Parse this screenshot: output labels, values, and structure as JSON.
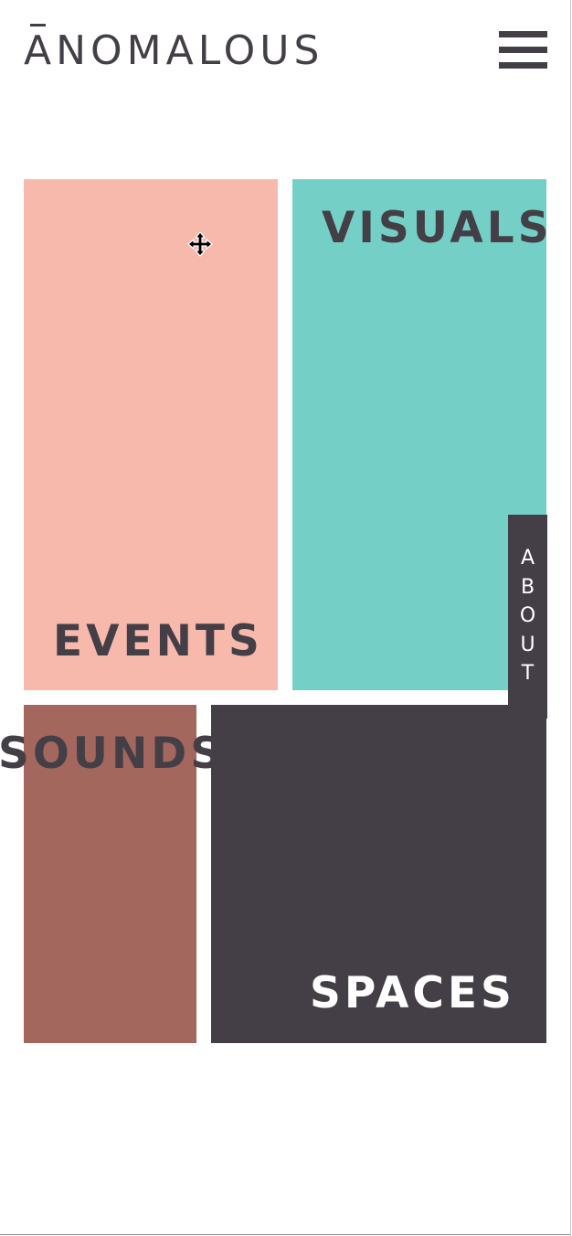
{
  "header": {
    "logo_text": "ANOMALOUS",
    "menu_icon": "hamburger-menu-icon"
  },
  "tiles": {
    "events": {
      "label": "EVENTS",
      "color": "#f7b9ac"
    },
    "visuals": {
      "label": "VISUALS",
      "color": "#74d0c6"
    },
    "sounds": {
      "label": "SOUNDS",
      "color": "#a3675e"
    },
    "spaces": {
      "label": "SPACES",
      "color": "#443f47"
    }
  },
  "about_tab": {
    "letters": [
      "A",
      "B",
      "O",
      "U",
      "T"
    ]
  },
  "colors": {
    "brand_dark": "#443f47",
    "background": "#ffffff",
    "on_dark_text": "#ffffff"
  },
  "cursor": {
    "icon": "move-cursor-icon"
  }
}
